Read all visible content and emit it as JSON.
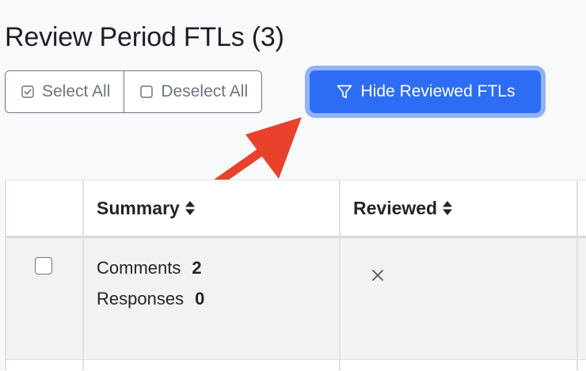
{
  "page": {
    "title": "Review Period FTLs (3)"
  },
  "toolbar": {
    "select_all_label": "Select All",
    "deselect_all_label": "Deselect All",
    "hide_reviewed_label": "Hide Reviewed FTLs",
    "select_all_icon": "checked-square-icon",
    "deselect_all_icon": "empty-square-icon",
    "hide_reviewed_icon": "filter-funnel-icon"
  },
  "table": {
    "columns": [
      {
        "label": "",
        "sortable": false
      },
      {
        "label": "Summary",
        "sortable": true
      },
      {
        "label": "Reviewed",
        "sortable": true
      }
    ],
    "rows": [
      {
        "selected": false,
        "summary": [
          {
            "label": "Comments",
            "value": "2"
          },
          {
            "label": "Responses",
            "value": "0"
          }
        ],
        "reviewed_icon": "x-mark-icon"
      }
    ]
  },
  "colors": {
    "primary": "#2d6df5",
    "focus_ring": "#91b2f6",
    "outline": "#6c757d",
    "annotation_arrow": "#e8412c",
    "row_background": "#f2f2f2"
  }
}
